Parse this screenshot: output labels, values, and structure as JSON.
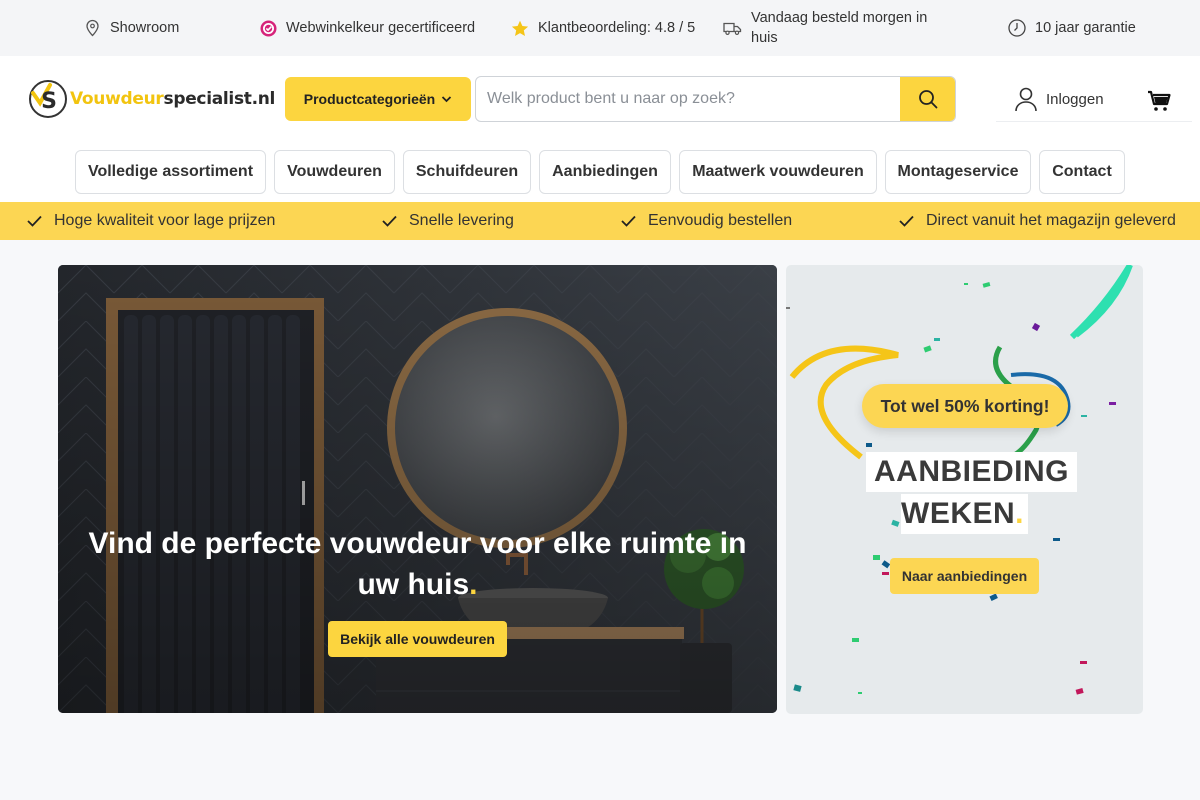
{
  "topbar": {
    "items": [
      {
        "label": "Showroom",
        "icon": "location-pin-icon"
      },
      {
        "label": "Webwinkelkeur gecertificeerd",
        "icon": "webwinkelkeur-icon"
      },
      {
        "label": "Klantbeoordeling: 4.8 / 5",
        "icon": "star-icon"
      },
      {
        "label_line1": "Vandaag besteld morgen in",
        "label_line2": "huis",
        "icon": "truck-icon"
      },
      {
        "label": "10 jaar garantie",
        "icon": "clock-icon"
      }
    ]
  },
  "header": {
    "logo_part1": "Vouwdeur",
    "logo_part2": "specialist.nl",
    "category_button": "Productcategorieën",
    "search_placeholder": "Welk product bent u naar op zoek?",
    "login_label": "Inloggen"
  },
  "nav": {
    "items": [
      "Volledige assortiment",
      "Vouwdeuren",
      "Schuifdeuren",
      "Aanbiedingen",
      "Maatwerk vouwdeuren",
      "Montageservice",
      "Contact"
    ]
  },
  "usp": {
    "items": [
      "Hoge kwaliteit voor lage prijzen",
      "Snelle levering",
      "Eenvoudig bestellen",
      "Direct vanuit het magazijn geleverd"
    ]
  },
  "hero": {
    "title": "Vind de perfecte vouwdeur voor elke ruimte in uw huis",
    "title_dot": ".",
    "button": "Bekijk alle vouwdeuren"
  },
  "promo": {
    "badge": "Tot wel 50% korting!",
    "title_line1": "AANBIEDING",
    "title_line2": "WEKEN",
    "title_dot": ".",
    "button": "Naar aanbiedingen"
  },
  "colors": {
    "accent": "#fcd53f",
    "usp_bar": "#fcd653",
    "topbar_bg": "#f4f5f7"
  }
}
